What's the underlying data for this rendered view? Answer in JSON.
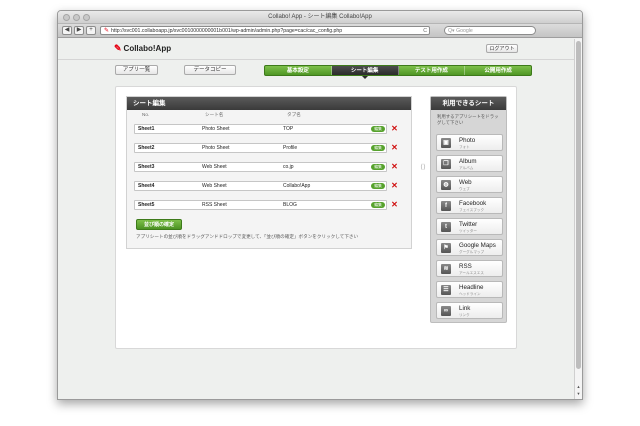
{
  "window": {
    "title": "Collabo! App - シート編集 Collabo!App"
  },
  "browser": {
    "back": "◀",
    "forward": "▶",
    "add": "+",
    "url": "http://svc001.collaboapp.jp/svc0010000000001b001/wp-admin/admin.php?page=cac/cac_config.php",
    "reload": "C",
    "search_placeholder": "Q▾ Google"
  },
  "header": {
    "logo": "Collabo!App",
    "logout": "ログアウト"
  },
  "buttons": {
    "app_list": "アプリ一覧",
    "data_copy": "データコピー"
  },
  "tabs": [
    {
      "label": "基本設定"
    },
    {
      "label": "シート編集"
    },
    {
      "label": "テスト用作成"
    },
    {
      "label": "公開用作成"
    }
  ],
  "sheet_edit": {
    "title": "シート編集",
    "columns": {
      "no": "No.",
      "name": "シート名",
      "tab": "タブ名"
    },
    "rows": [
      {
        "no": "Sheet1",
        "name": "Photo Sheet",
        "tab": "TOP",
        "edit": "編集",
        "delete": "✕"
      },
      {
        "no": "Sheet2",
        "name": "Photo Sheet",
        "tab": "Profile",
        "edit": "編集",
        "delete": "✕"
      },
      {
        "no": "Sheet3",
        "name": "Web Sheet",
        "tab": "co.jp",
        "edit": "編集",
        "delete": "✕"
      },
      {
        "no": "Sheet4",
        "name": "Web Sheet",
        "tab": "Collabo!App",
        "edit": "編集",
        "delete": "✕"
      },
      {
        "no": "Sheet5",
        "name": "RSS Sheet",
        "tab": "BLOG",
        "edit": "編集",
        "delete": "✕"
      }
    ],
    "save_order": "並び順の確定",
    "help": "アプリシートの並び順をドラッグアンドドロップで変更して、「並び順の確定」ボタンをクリックして下さい"
  },
  "available": {
    "title": "利用できるシート",
    "desc": "利用するアプリシートをドラッグして下さい",
    "items": [
      {
        "label": "Photo",
        "sub": "フォト",
        "icon": "photo-icon",
        "glyph": "▣"
      },
      {
        "label": "Album",
        "sub": "アルバム",
        "icon": "album-icon",
        "glyph": "❐"
      },
      {
        "label": "Web",
        "sub": "ウェブ",
        "icon": "web-icon",
        "glyph": "◍"
      },
      {
        "label": "Facebook",
        "sub": "フェイスブック",
        "icon": "facebook-icon",
        "glyph": "f"
      },
      {
        "label": "Twitter",
        "sub": "ツイッター",
        "icon": "twitter-icon",
        "glyph": "t"
      },
      {
        "label": "Google Maps",
        "sub": "グーグルマップ",
        "icon": "map-flag-icon",
        "glyph": "⚑"
      },
      {
        "label": "RSS",
        "sub": "アールエスエス",
        "icon": "rss-icon",
        "glyph": "≋"
      },
      {
        "label": "Headline",
        "sub": "ヘッドライン",
        "icon": "headline-icon",
        "glyph": "☰"
      },
      {
        "label": "Link",
        "sub": "リンク",
        "icon": "link-icon",
        "glyph": "∞"
      }
    ]
  },
  "colors": {
    "accent_green": "#56a22c",
    "dark_header": "#3a3a3a",
    "delete_red": "#d01010"
  }
}
